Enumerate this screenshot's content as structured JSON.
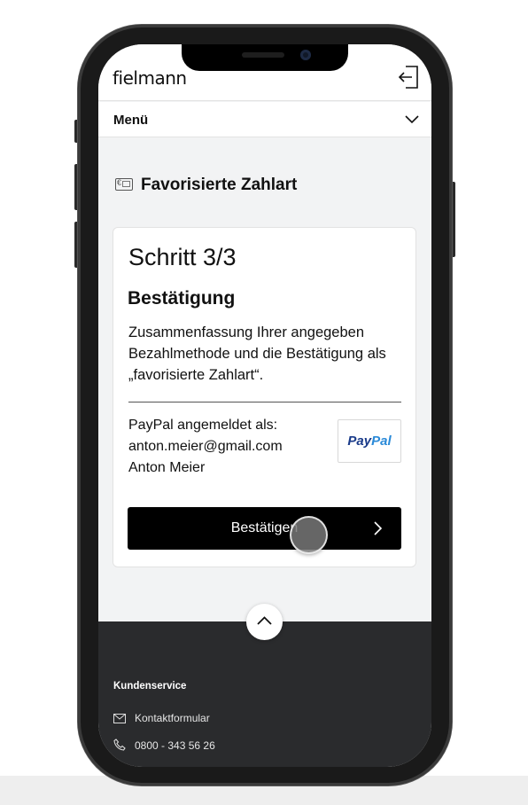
{
  "header": {
    "logo": "fielmann",
    "logout_icon": "logout-icon"
  },
  "menu": {
    "label": "Menü",
    "chevron_icon": "chevron-down-icon"
  },
  "section": {
    "icon": "payment-card-icon",
    "title": "Favorisierte Zahlart"
  },
  "card": {
    "step": "Schritt 3/3",
    "heading": "Bestätigung",
    "summary": "Zusammenfassung Ihrer angegeben Bezahlmethode und die Bestätigung als „favorisierte Zahlart“.",
    "paypal_label": "PayPal angemeldet als:",
    "paypal_email": "anton.meier@gmail.com",
    "paypal_name": "Anton Meier",
    "paypal_logo_pay": "Pay",
    "paypal_logo_pal": "Pal",
    "confirm_button": "Bestätigen"
  },
  "footer": {
    "back_to_top_icon": "chevron-up-icon",
    "title": "Kundenservice",
    "contact_label": "Kontaktformular",
    "phone": "0800 - 343 56 26"
  },
  "colors": {
    "button": "#000000",
    "footer": "#2a2b2d",
    "paypal_dark": "#1a3b8a",
    "paypal_light": "#2a8ad8",
    "background": "#f2f3f4"
  }
}
